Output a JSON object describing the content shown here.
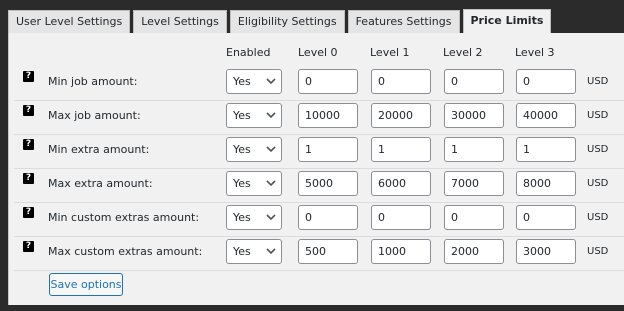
{
  "tabs": [
    {
      "label": "User Level Settings",
      "active": false
    },
    {
      "label": "Level Settings",
      "active": false
    },
    {
      "label": "Eligibility Settings",
      "active": false
    },
    {
      "label": "Features Settings",
      "active": false
    },
    {
      "label": "Price Limits",
      "active": true
    }
  ],
  "columns": {
    "enabled": "Enabled",
    "level0": "Level 0",
    "level1": "Level 1",
    "level2": "Level 2",
    "level3": "Level 3"
  },
  "rows": [
    {
      "help": "?",
      "label": "Min job amount:",
      "enabled": "Yes",
      "values": [
        "0",
        "0",
        "0",
        "0"
      ],
      "unit": "USD"
    },
    {
      "help": "?",
      "label": "Max job amount:",
      "enabled": "Yes",
      "values": [
        "10000",
        "20000",
        "30000",
        "40000"
      ],
      "unit": "USD"
    },
    {
      "help": "?",
      "label": "Min extra amount:",
      "enabled": "Yes",
      "values": [
        "1",
        "1",
        "1",
        "1"
      ],
      "unit": "USD"
    },
    {
      "help": "?",
      "label": "Max extra amount:",
      "enabled": "Yes",
      "values": [
        "5000",
        "6000",
        "7000",
        "8000"
      ],
      "unit": "USD"
    },
    {
      "help": "?",
      "label": "Min custom extras amount:",
      "enabled": "Yes",
      "values": [
        "0",
        "0",
        "0",
        "0"
      ],
      "unit": "USD"
    },
    {
      "help": "?",
      "label": "Max custom extras amount:",
      "enabled": "Yes",
      "values": [
        "500",
        "1000",
        "2000",
        "3000"
      ],
      "unit": "USD"
    }
  ],
  "save_label": "Save options",
  "colors": {
    "accent": "#2271b1",
    "background": "#f1f1f1",
    "frame": "#2b2b2b"
  },
  "icons": {
    "help": "question-mark-icon",
    "select": "chevron-down-icon"
  }
}
